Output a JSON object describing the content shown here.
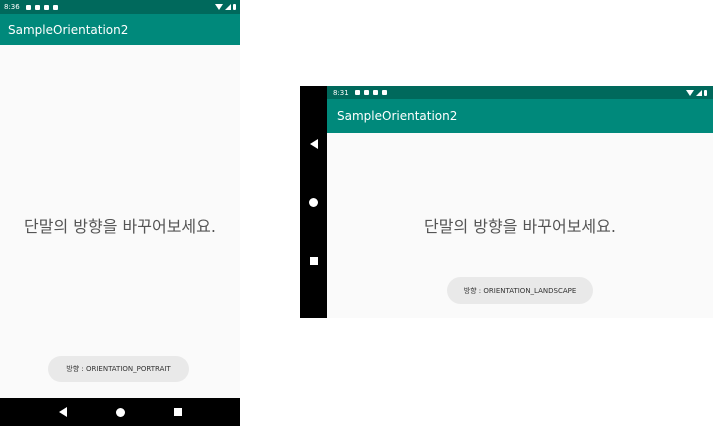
{
  "portrait": {
    "status_time": "8:36",
    "app_title": "SampleOrientation2",
    "message": "단말의 방향을 바꾸어보세요.",
    "orientation_button": "방향 : ORIENTATION_PORTRAIT"
  },
  "landscape": {
    "status_time": "8:31",
    "app_title": "SampleOrientation2",
    "message": "단말의 방향을 바꾸어보세요.",
    "orientation_button": "방향 : ORIENTATION_LANDSCAPE"
  },
  "colors": {
    "status_bar": "#00695c",
    "app_bar": "#00897b",
    "nav_bar": "#000000",
    "background": "#fafafa"
  }
}
